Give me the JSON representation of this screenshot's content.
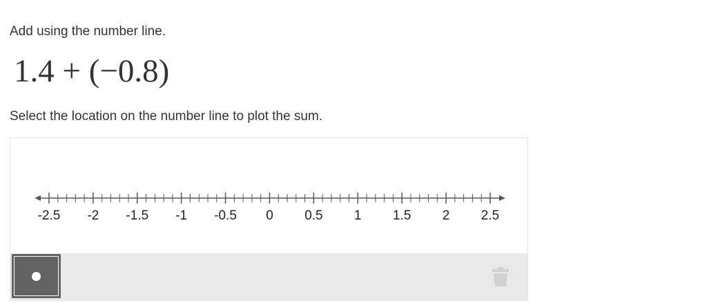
{
  "question": {
    "instruction": "Add using the number line.",
    "expression": "1.4 + (−0.8)",
    "prompt": "Select the location on the number line to plot the sum."
  },
  "number_line": {
    "min": -2.5,
    "max": 2.5,
    "major_step": 0.5,
    "minor_step": 0.1,
    "tick_labels": [
      "-2.5",
      "-2",
      "-1.5",
      "-1",
      "-0.5",
      "0",
      "0.5",
      "1",
      "1.5",
      "2",
      "2.5"
    ],
    "colors": {
      "axis": "#555555",
      "label": "#222222"
    }
  },
  "toolbar": {
    "tools": [
      {
        "name": "point",
        "icon": "point-icon",
        "selected": true
      },
      {
        "name": "delete",
        "icon": "trash-icon",
        "selected": false
      }
    ]
  }
}
